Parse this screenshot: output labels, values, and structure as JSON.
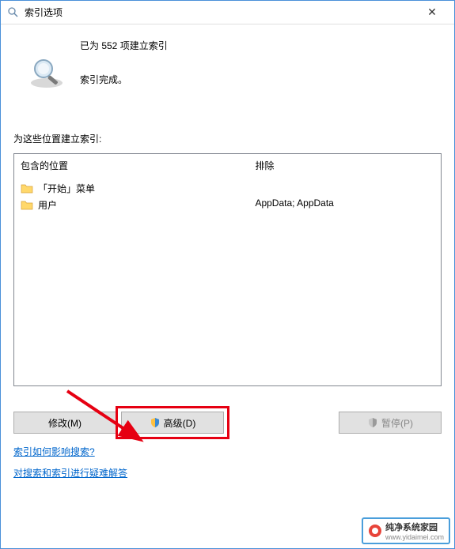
{
  "titlebar": {
    "title": "索引选项",
    "close": "✕"
  },
  "status": {
    "count_text": "已为 552 项建立索引",
    "complete_text": "索引完成。"
  },
  "section_label": "为这些位置建立索引:",
  "columns": {
    "included": "包含的位置",
    "excluded": "排除"
  },
  "locations": {
    "items": [
      {
        "label": "「开始」菜单"
      },
      {
        "label": "用户"
      }
    ],
    "excluded_text": "AppData; AppData"
  },
  "buttons": {
    "modify": "修改(M)",
    "advanced": "高级(D)",
    "pause": "暂停(P)"
  },
  "links": {
    "how_affects": "索引如何影响搜索?",
    "troubleshoot": "对搜索和索引进行疑难解答"
  },
  "watermark": {
    "name": "纯净系统家园",
    "url": "www.yidaimei.com"
  }
}
